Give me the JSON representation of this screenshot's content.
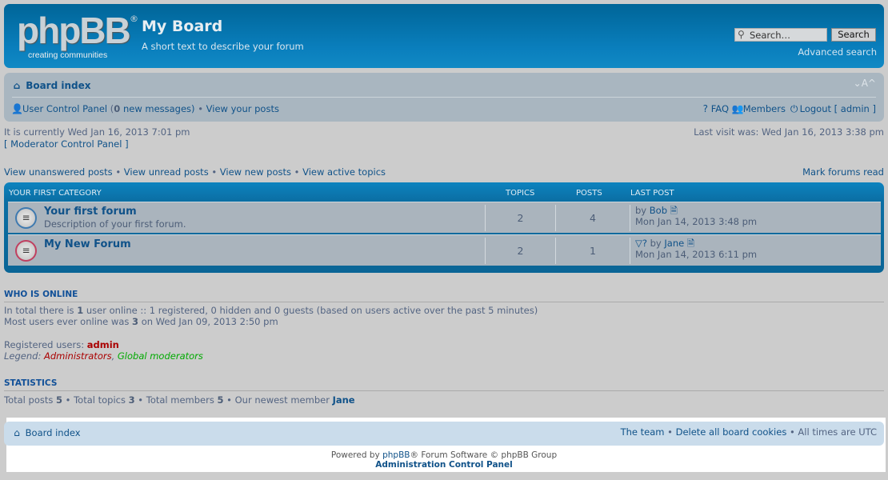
{
  "header": {
    "logo_text": "phpBB",
    "logo_tagline": "creating communities",
    "title": "My Board",
    "description": "A short text to describe your forum",
    "search_placeholder": "Search…",
    "search_button": "Search",
    "advanced_search": "Advanced search"
  },
  "navbar": {
    "board_index": "Board index",
    "font_size_controls": "⌄A^",
    "ucp": "User Control Panel",
    "ucp_open": " (",
    "new_count": "0",
    "new_messages": " new messages)",
    "sep": " • ",
    "view_posts": "View your posts",
    "faq": "FAQ",
    "members": "Members",
    "logout": "Logout [ admin ]"
  },
  "status": {
    "current_time": "It is currently Wed Jan 16, 2013 7:01 pm",
    "mcp": "[ Moderator Control Panel ]",
    "last_visit": "Last visit was: Wed Jan 16, 2013 3:38 pm"
  },
  "quick_links": [
    "View unanswered posts",
    "View unread posts",
    "View new posts",
    "View active topics"
  ],
  "mark_read": "Mark forums read",
  "category": {
    "name": "YOUR FIRST CATEGORY",
    "col_topics": "TOPICS",
    "col_posts": "POSTS",
    "col_last": "LAST POST",
    "forums": [
      {
        "title": "Your first forum",
        "description": "Description of your first forum.",
        "topics": "2",
        "posts": "4",
        "by": "by ",
        "author": "Bob",
        "date": "Mon Jan 14, 2013 3:48 pm",
        "unread": false
      },
      {
        "title": "My New Forum",
        "description": "",
        "topics": "2",
        "posts": "1",
        "by": "by ",
        "author": "Jane",
        "date": "Mon Jan 14, 2013 6:11 pm",
        "unread": true
      }
    ]
  },
  "online": {
    "heading": "WHO IS ONLINE",
    "l1a": "In total there is ",
    "l1b": "1",
    "l1c": " user online :: 1 registered, 0 hidden and 0 guests (based on users active over the past 5 minutes)",
    "l2a": "Most users ever online was ",
    "l2b": "3",
    "l2c": " on Wed Jan 09, 2013 2:50 pm",
    "reg_label": "Registered users: ",
    "reg_user": "admin",
    "legend_label": "Legend: ",
    "legend_admin": "Administrators",
    "legend_gm": "Global moderators",
    "admin_color": "#aa0000",
    "gm_color": "#00aa00"
  },
  "stats": {
    "heading": "STATISTICS",
    "a": "Total posts ",
    "posts": "5",
    "b": " • Total topics ",
    "topics": "3",
    "c": " • Total members ",
    "members": "5",
    "d": " • Our newest member ",
    "newest": "Jane"
  },
  "footer": {
    "board_index": "Board index",
    "team": "The team",
    "delete_cookies": "Delete all board cookies",
    "times": " • All times are UTC",
    "powered_a": "Powered by ",
    "powered_link": "phpBB",
    "powered_b": "® Forum Software © phpBB Group",
    "acp": "Administration Control Panel"
  }
}
